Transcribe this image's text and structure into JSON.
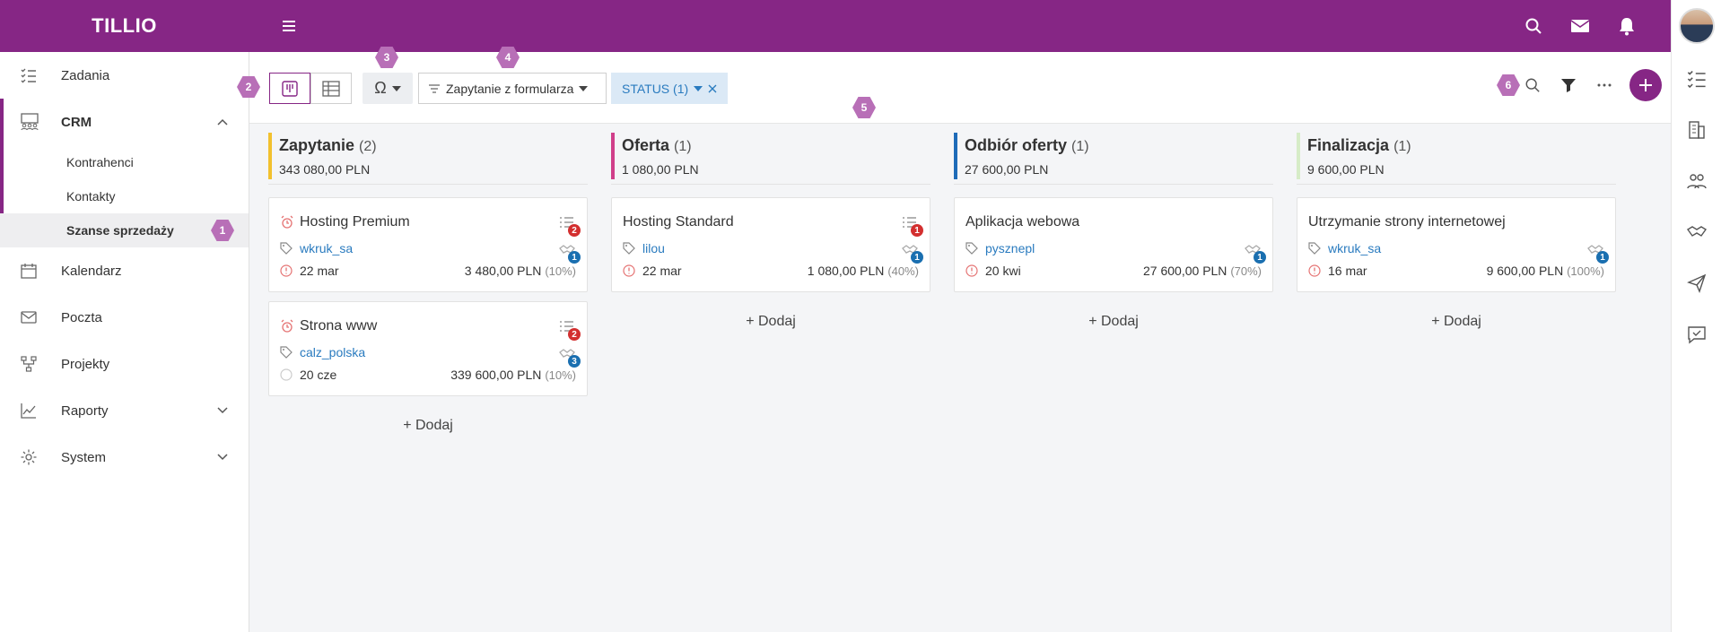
{
  "app": {
    "title": "TILLIO"
  },
  "sidebar": {
    "items": [
      {
        "label": "Zadania",
        "icon": "tasks-icon"
      },
      {
        "label": "CRM",
        "icon": "crm-icon"
      },
      {
        "label": "Kalendarz",
        "icon": "calendar-icon"
      },
      {
        "label": "Poczta",
        "icon": "mail-icon"
      },
      {
        "label": "Projekty",
        "icon": "projects-icon"
      },
      {
        "label": "Raporty",
        "icon": "chart-icon"
      },
      {
        "label": "System",
        "icon": "gear-icon"
      }
    ],
    "crm_sub": [
      "Kontrahenci",
      "Kontakty",
      "Szanse sprzedaży"
    ]
  },
  "callouts": [
    "1",
    "2",
    "3",
    "4",
    "5",
    "6"
  ],
  "toolbar": {
    "form_filter": "Zapytanie z formularza",
    "status_filter": "STATUS (1)"
  },
  "columns": [
    {
      "title": "Zapytanie",
      "count": "(2)",
      "amount": "343 080,00 PLN",
      "color": "#f2c12e"
    },
    {
      "title": "Oferta",
      "count": "(1)",
      "amount": "1 080,00 PLN",
      "color": "#d03f8a"
    },
    {
      "title": "Odbiór oferty",
      "count": "(1)",
      "amount": "27 600,00 PLN",
      "color": "#1e6bb8"
    },
    {
      "title": "Finalizacja",
      "count": "(1)",
      "amount": "9 600,00 PLN",
      "color": "#d6ecc7"
    }
  ],
  "cards": [
    {
      "title": "Hosting Premium",
      "tag": "wkruk_sa",
      "date": "22 mar",
      "value": "3 480,00 PLN",
      "pct": "(10%)",
      "tasks": "2",
      "contacts": "1"
    },
    {
      "title": "Strona www",
      "tag": "calz_polska",
      "date": "20 cze",
      "value": "339 600,00 PLN",
      "pct": "(10%)",
      "tasks": "2",
      "contacts": "3"
    },
    {
      "title": "Hosting Standard",
      "tag": "lilou",
      "date": "22 mar",
      "value": "1 080,00 PLN",
      "pct": "(40%)",
      "tasks": "1",
      "contacts": "1"
    },
    {
      "title": "Aplikacja webowa",
      "tag": "pysznepl",
      "date": "20 kwi",
      "value": "27 600,00 PLN",
      "pct": "(70%)",
      "contacts": "1"
    },
    {
      "title": "Utrzymanie strony internetowej",
      "tag": "wkruk_sa",
      "date": "16 mar",
      "value": "9 600,00 PLN",
      "pct": "(100%)",
      "contacts": "1"
    }
  ],
  "add_label": "+ Dodaj"
}
